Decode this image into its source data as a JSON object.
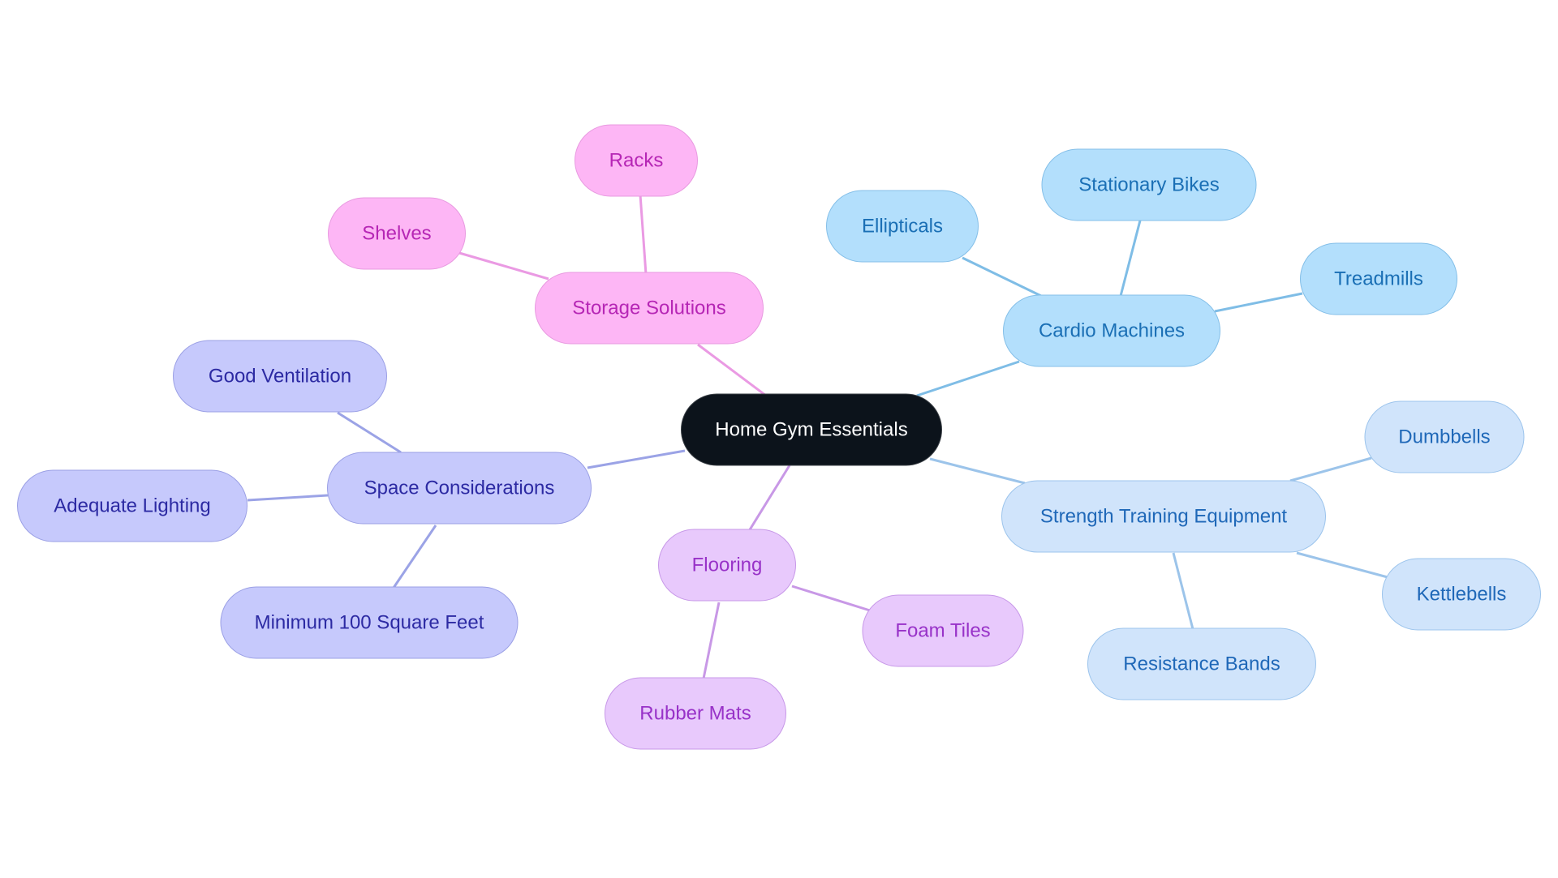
{
  "title": "Home Gym Essentials",
  "colors": {
    "root": "#0c131b",
    "storage": "#fdb6f5",
    "cardio": "#b3dffc",
    "strength": "#d0e4fb",
    "space": "#c6c9fc",
    "flooring": "#e8c9fc",
    "edge_storage": "#ea9ae3",
    "edge_cardio": "#7fbde6",
    "edge_strength": "#9cc4ea",
    "edge_space": "#9ba3e6",
    "edge_flooring": "#c898e6"
  },
  "root": {
    "id": "root",
    "label": "Home Gym Essentials"
  },
  "branches": [
    {
      "id": "storage",
      "label": "Storage Solutions",
      "children": [
        {
          "id": "racks",
          "label": "Racks"
        },
        {
          "id": "shelves",
          "label": "Shelves"
        }
      ]
    },
    {
      "id": "cardio",
      "label": "Cardio Machines",
      "children": [
        {
          "id": "ellipticals",
          "label": "Ellipticals"
        },
        {
          "id": "bikes",
          "label": "Stationary Bikes"
        },
        {
          "id": "treadmills",
          "label": "Treadmills"
        }
      ]
    },
    {
      "id": "strength",
      "label": "Strength Training Equipment",
      "children": [
        {
          "id": "dumbbells",
          "label": "Dumbbells"
        },
        {
          "id": "kettlebells",
          "label": "Kettlebells"
        },
        {
          "id": "bands",
          "label": "Resistance Bands"
        }
      ]
    },
    {
      "id": "flooring",
      "label": "Flooring",
      "children": [
        {
          "id": "foam",
          "label": "Foam Tiles"
        },
        {
          "id": "rubber",
          "label": "Rubber Mats"
        }
      ]
    },
    {
      "id": "space",
      "label": "Space Considerations",
      "children": [
        {
          "id": "ventilation",
          "label": "Good Ventilation"
        },
        {
          "id": "lighting",
          "label": "Adequate Lighting"
        },
        {
          "id": "sqft",
          "label": "Minimum 100 Square Feet"
        }
      ]
    }
  ]
}
